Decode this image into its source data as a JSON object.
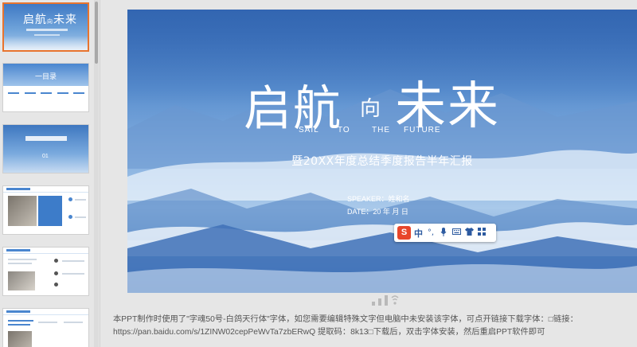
{
  "thumbnails": {
    "slide1": {
      "title_main": "启航",
      "title_small": "向",
      "title_end": "未来"
    },
    "slide2": {
      "label": "一目录"
    },
    "slide3": {
      "number": "01"
    }
  },
  "slide": {
    "title_part1": "启航",
    "title_part2": "向",
    "title_part3": "未来",
    "english_words": [
      "SAIL",
      "TO",
      "THE",
      "FUTURE"
    ],
    "subtitle": "暨20XX年度总结季度报告半年汇报",
    "speaker": "SPEAKER：姓和名",
    "date": "DATE：20  年  月  日"
  },
  "ime_toolbar": {
    "logo": "S",
    "mode": "中",
    "icons": [
      "punctuation-icon",
      "microphone-icon",
      "keyboard-icon",
      "skin-icon",
      "toolbox-icon"
    ],
    "glyphs": [
      "°,",
      "🎤",
      "⌨",
      "👕",
      "▦"
    ]
  },
  "notes": {
    "text": "本PPT制作时使用了\"字魂50号-白鸽天行体\"字体，如您需要编辑特殊文字但电脑中未安装该字体，可点开链接下载字体：□链接：https://pan.baidu.com/s/1ZINW02cepPeWvTa7zbERwQ 提取码：8k13□下载后，双击字体安装，然后重启PPT软件即可"
  },
  "colors": {
    "selection": "#e8742e",
    "slide_sky": "#5a8fcf",
    "ime_red": "#e8462b"
  }
}
